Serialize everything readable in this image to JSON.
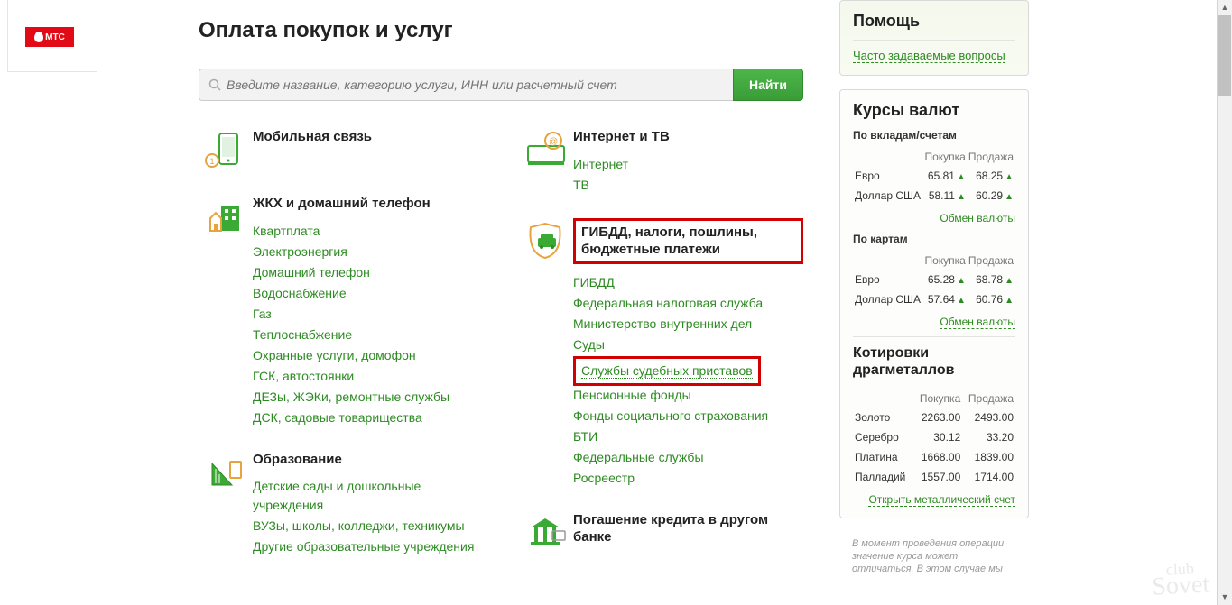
{
  "mts": {
    "label": "МТС"
  },
  "page_title": "Оплата покупок и услуг",
  "search": {
    "placeholder": "Введите название, категорию услуги, ИНН или расчетный счет",
    "button": "Найти"
  },
  "categories": {
    "left": [
      {
        "title": "Мобильная связь",
        "icon": "phone-icon",
        "links": []
      },
      {
        "title": "ЖКХ и домашний телефон",
        "icon": "house-icon",
        "links": [
          "Квартплата",
          "Электроэнергия",
          "Домашний телефон",
          "Водоснабжение",
          "Газ",
          "Теплоснабжение",
          "Охранные услуги, домофон",
          "ГСК, автостоянки",
          "ДЕЗы, ЖЭКи, ремонтные службы",
          "ДСК, садовые товарищества"
        ]
      },
      {
        "title": "Образование",
        "icon": "education-icon",
        "links": [
          "Детские сады и дошкольные учреждения",
          "ВУЗы, школы, колледжи, техникумы",
          "Другие образовательные учреждения"
        ]
      }
    ],
    "right": [
      {
        "title": "Интернет и ТВ",
        "icon": "tv-icon",
        "links": [
          "Интернет",
          "ТВ"
        ]
      },
      {
        "title": "ГИБДД, налоги, пошлины, бюджетные платежи",
        "icon": "gov-icon",
        "highlighted": true,
        "links": [
          "ГИБДД",
          "Федеральная налоговая служба",
          "Министерство внутренних дел",
          "Суды",
          "Службы судебных приставов",
          "Пенсионные фонды",
          "Фонды социального страхования",
          "БТИ",
          "Федеральные службы",
          "Росреестр"
        ],
        "highlighted_link_index": 4
      },
      {
        "title": "Погашение кредита в другом банке",
        "icon": "bank-icon",
        "links": []
      }
    ]
  },
  "help": {
    "title": "Помощь",
    "faq": "Часто задаваемые вопросы"
  },
  "rates": {
    "title": "Курсы валют",
    "by_accounts": "По вкладам/счетам",
    "by_cards": "По картам",
    "headers": {
      "buy": "Покупка",
      "sell": "Продажа"
    },
    "accounts": [
      {
        "name": "Евро",
        "buy": "65.81",
        "sell": "68.25"
      },
      {
        "name": "Доллар США",
        "buy": "58.11",
        "sell": "60.29"
      }
    ],
    "cards": [
      {
        "name": "Евро",
        "buy": "65.28",
        "sell": "68.78"
      },
      {
        "name": "Доллар США",
        "buy": "57.64",
        "sell": "60.76"
      }
    ],
    "exchange_link": "Обмен валюты"
  },
  "metals": {
    "title": "Котировки драгметаллов",
    "headers": {
      "buy": "Покупка",
      "sell": "Продажа"
    },
    "rows": [
      {
        "name": "Золото",
        "buy": "2263.00",
        "sell": "2493.00"
      },
      {
        "name": "Серебро",
        "buy": "30.12",
        "sell": "33.20"
      },
      {
        "name": "Платина",
        "buy": "1668.00",
        "sell": "1839.00"
      },
      {
        "name": "Палладий",
        "buy": "1557.00",
        "sell": "1714.00"
      }
    ],
    "open_link": "Открыть металлический счет"
  },
  "fine_print": "В момент проведения операции значение курса может отличаться. В этом случае мы",
  "watermark": {
    "line1": "club",
    "line2": "Sovet"
  }
}
